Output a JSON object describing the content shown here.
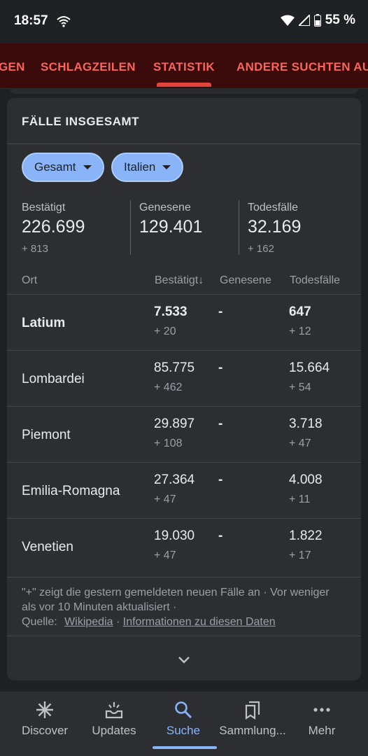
{
  "status": {
    "time": "18:57",
    "battery": "55 %"
  },
  "tabs": [
    {
      "label": "GEN"
    },
    {
      "label": "SCHLAGZEILEN"
    },
    {
      "label": "STATISTIK"
    },
    {
      "label": "ANDERE SUCHTEN AU"
    }
  ],
  "card": {
    "title": "FÄLLE INSGESAMT",
    "chips": [
      "Gesamt",
      "Italien"
    ],
    "summary": [
      {
        "label": "Bestätigt",
        "value": "226.699",
        "delta": "+ 813"
      },
      {
        "label": "Genesene",
        "value": "129.401",
        "delta": ""
      },
      {
        "label": "Todesfälle",
        "value": "32.169",
        "delta": "+ 162"
      }
    ],
    "columns": [
      "Ort",
      "Bestätigt↓",
      "Genesene",
      "Todesfälle"
    ],
    "rows": [
      {
        "ort": "Latium",
        "bestaetigt": "7.533",
        "bestaetigt_delta": "+ 20",
        "genesene": "-",
        "todesfaelle": "647",
        "todesfaelle_delta": "+ 12"
      },
      {
        "ort": "Lombardei",
        "bestaetigt": "85.775",
        "bestaetigt_delta": "+ 462",
        "genesene": "-",
        "todesfaelle": "15.664",
        "todesfaelle_delta": "+ 54"
      },
      {
        "ort": "Piemont",
        "bestaetigt": "29.897",
        "bestaetigt_delta": "+ 108",
        "genesene": "-",
        "todesfaelle": "3.718",
        "todesfaelle_delta": "+ 47"
      },
      {
        "ort": "Emilia-Romagna",
        "bestaetigt": "27.364",
        "bestaetigt_delta": "+ 47",
        "genesene": "-",
        "todesfaelle": "4.008",
        "todesfaelle_delta": "+ 11"
      },
      {
        "ort": "Venetien",
        "bestaetigt": "19.030",
        "bestaetigt_delta": "+ 47",
        "genesene": "-",
        "todesfaelle": "1.822",
        "todesfaelle_delta": "+ 17"
      }
    ],
    "footnote": {
      "line1": "\"+\" zeigt die gestern gemeldeten neuen Fälle an · Vor weniger als vor 10 Minuten aktualisiert ·",
      "source_label": "Quelle:",
      "source_link": "Wikipedia",
      "info_link": "Informationen zu diesen Daten"
    }
  },
  "nav": [
    {
      "label": "Discover",
      "icon": "asterisk-icon"
    },
    {
      "label": "Updates",
      "icon": "updates-tray-icon"
    },
    {
      "label": "Suche",
      "icon": "search-icon"
    },
    {
      "label": "Sammlung...",
      "icon": "bookmarks-icon"
    },
    {
      "label": "Mehr",
      "icon": "more-dots-icon"
    }
  ],
  "colors": {
    "accent": "#8ab4f8",
    "tab_text": "#f6655f",
    "tab_bg": "#3b0b0b"
  }
}
